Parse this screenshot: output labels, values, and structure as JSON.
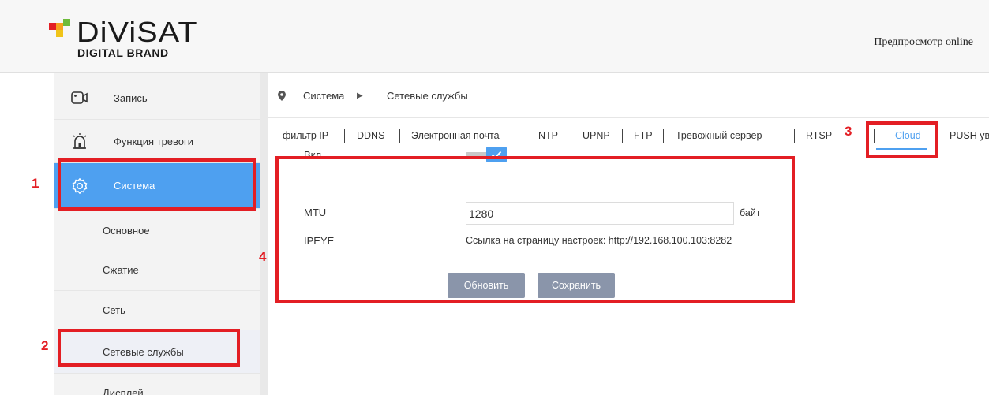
{
  "header": {
    "brand": "DiViSAT",
    "brand_sub": "DIGITAL BRAND",
    "preview_link": "Предпросмотр online"
  },
  "sidebar": {
    "items": [
      {
        "label": "Запись",
        "icon": "camera-icon"
      },
      {
        "label": "Функция тревоги",
        "icon": "alarm-siren-icon"
      },
      {
        "label": "Система",
        "icon": "gear-icon",
        "active": true
      },
      {
        "label": "Основное"
      },
      {
        "label": "Сжатие"
      },
      {
        "label": "Сеть"
      },
      {
        "label": "Сетевые службы",
        "selected": true
      },
      {
        "label": "Дисплей"
      }
    ]
  },
  "breadcrumb": {
    "icon": "location-pin-icon",
    "level1": "Система",
    "separator": "▶",
    "level2": "Сетевые службы"
  },
  "tabs": [
    {
      "label": "фильтр IP"
    },
    {
      "label": "DDNS"
    },
    {
      "label": "Электронная почта"
    },
    {
      "label": "NTP"
    },
    {
      "label": "UPNP"
    },
    {
      "label": "FTP"
    },
    {
      "label": "Тревожный сервер"
    },
    {
      "label": "RTSP"
    },
    {
      "label": "Cloud",
      "active": true
    },
    {
      "label": "PUSH ув"
    }
  ],
  "form": {
    "enable_label": "Вкл.",
    "enable_checked": true,
    "mtu_label": "MTU",
    "mtu_value": "1280",
    "mtu_unit": "байт",
    "ipeye_label": "IPEYE",
    "ipeye_text": "Ссылка на страницу настроек: http://192.168.100.103:8282",
    "refresh_button": "Обновить",
    "save_button": "Сохранить"
  },
  "annotations": {
    "n1": "1",
    "n2": "2",
    "n3": "3",
    "n4": "4"
  },
  "colors": {
    "accent": "#4ea0f0",
    "annotation": "#e31e24",
    "button": "#8a95aa"
  }
}
